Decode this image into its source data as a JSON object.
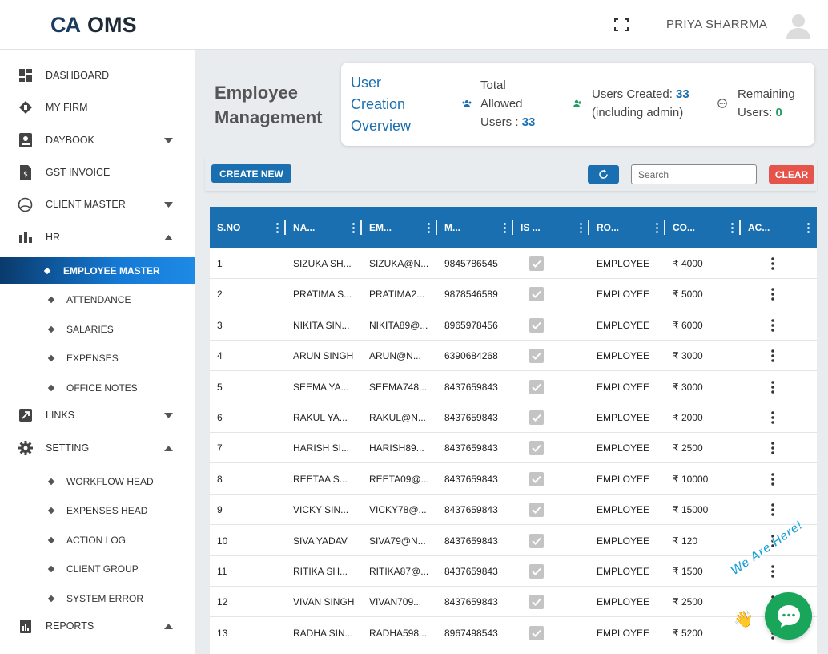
{
  "header": {
    "logo_mark": "CA",
    "logo_name": "OMS",
    "user_name": "PRIYA SHARRMA",
    "icons": {
      "fullscreen": "fullscreen-icon",
      "avatar": "user-avatar-icon"
    }
  },
  "sidebar": {
    "items": [
      {
        "label": "DASHBOARD",
        "icon": "dashboard-icon"
      },
      {
        "label": "MY FIRM",
        "icon": "firm-icon"
      },
      {
        "label": "DAYBOOK",
        "icon": "daybook-icon",
        "expandable": true
      },
      {
        "label": "GST INVOICE",
        "icon": "invoice-icon"
      },
      {
        "label": "CLIENT MASTER",
        "icon": "client-icon",
        "expandable": true
      },
      {
        "label": "HR",
        "icon": "bar-chart-icon",
        "expanded": true
      },
      {
        "label": "LINKS",
        "icon": "link-icon",
        "expandable": true
      },
      {
        "label": "SETTING",
        "icon": "gear-icon",
        "expanded": true
      },
      {
        "label": "REPORTS",
        "icon": "report-icon",
        "expanded": true
      }
    ],
    "hr_sub": [
      {
        "label": "EMPLOYEE MASTER",
        "active": true
      },
      {
        "label": "ATTENDANCE"
      },
      {
        "label": "SALARIES"
      },
      {
        "label": "EXPENSES"
      },
      {
        "label": "OFFICE NOTES"
      }
    ],
    "setting_sub": [
      {
        "label": "WORKFLOW HEAD"
      },
      {
        "label": "EXPENSES HEAD"
      },
      {
        "label": "ACTION LOG"
      },
      {
        "label": "CLIENT GROUP"
      },
      {
        "label": "SYSTEM ERROR"
      }
    ]
  },
  "page": {
    "title_line1": "Employee",
    "title_line2": "Management"
  },
  "overview": {
    "title_line1": "User",
    "title_line2": "Creation",
    "title_line3": "Overview",
    "total_line1": "Total",
    "total_line2": "Allowed",
    "total_line3": "Users : ",
    "total_value": "33",
    "created_label": "Users Created: ",
    "created_value": "33",
    "created_note": "(including admin)",
    "remaining_line1": "Remaining",
    "remaining_label": "Users: ",
    "remaining_value": "0",
    "accent_color": "#1a6fb0",
    "remaining_color": "#1e9e62"
  },
  "toolbar": {
    "create_label": "CREATE NEW",
    "search_placeholder": "Search",
    "clear_label": "CLEAR",
    "refresh_icon": "refresh-icon"
  },
  "table": {
    "columns": [
      "S.NO",
      "NA...",
      "EM...",
      "M...",
      "IS ...",
      "RO...",
      "CO...",
      "AC..."
    ],
    "rows": [
      {
        "sno": "1",
        "name": "SIZUKA SH...",
        "email": "SIZUKA@N...",
        "mobile": "9845786545",
        "role": "EMPLOYEE",
        "cost": "₹ 4000"
      },
      {
        "sno": "2",
        "name": "PRATIMA S...",
        "email": "PRATIMA2...",
        "mobile": "9878546589",
        "role": "EMPLOYEE",
        "cost": "₹ 5000"
      },
      {
        "sno": "3",
        "name": "NIKITA SIN...",
        "email": "NIKITA89@...",
        "mobile": "8965978456",
        "role": "EMPLOYEE",
        "cost": "₹ 6000"
      },
      {
        "sno": "4",
        "name": "ARUN SINGH",
        "email": "ARUN@N...",
        "mobile": "6390684268",
        "role": "EMPLOYEE",
        "cost": "₹ 3000"
      },
      {
        "sno": "5",
        "name": "SEEMA YA...",
        "email": "SEEMA748...",
        "mobile": "8437659843",
        "role": "EMPLOYEE",
        "cost": "₹ 3000"
      },
      {
        "sno": "6",
        "name": "RAKUL YA...",
        "email": "RAKUL@N...",
        "mobile": "8437659843",
        "role": "EMPLOYEE",
        "cost": "₹ 2000"
      },
      {
        "sno": "7",
        "name": "HARISH SI...",
        "email": "HARISH89...",
        "mobile": "8437659843",
        "role": "EMPLOYEE",
        "cost": "₹ 2500"
      },
      {
        "sno": "8",
        "name": "REETAA S...",
        "email": "REETA09@...",
        "mobile": "8437659843",
        "role": "EMPLOYEE",
        "cost": "₹ 10000"
      },
      {
        "sno": "9",
        "name": "VICKY SIN...",
        "email": "VICKY78@...",
        "mobile": "8437659843",
        "role": "EMPLOYEE",
        "cost": "₹ 15000"
      },
      {
        "sno": "10",
        "name": "SIVA YADAV",
        "email": "SIVA79@N...",
        "mobile": "8437659843",
        "role": "EMPLOYEE",
        "cost": "₹ 120"
      },
      {
        "sno": "11",
        "name": "RITIKA SH...",
        "email": "RITIKA87@...",
        "mobile": "8437659843",
        "role": "EMPLOYEE",
        "cost": "₹ 1500"
      },
      {
        "sno": "12",
        "name": "VIVAN SINGH",
        "email": "VIVAN709...",
        "mobile": "8437659843",
        "role": "EMPLOYEE",
        "cost": "₹ 2500"
      },
      {
        "sno": "13",
        "name": "RADHA SIN...",
        "email": "RADHA598...",
        "mobile": "8967498543",
        "role": "EMPLOYEE",
        "cost": "₹ 5200"
      }
    ]
  },
  "chat": {
    "tag": "We Are Here!",
    "icon": "chat-bubble-icon"
  }
}
